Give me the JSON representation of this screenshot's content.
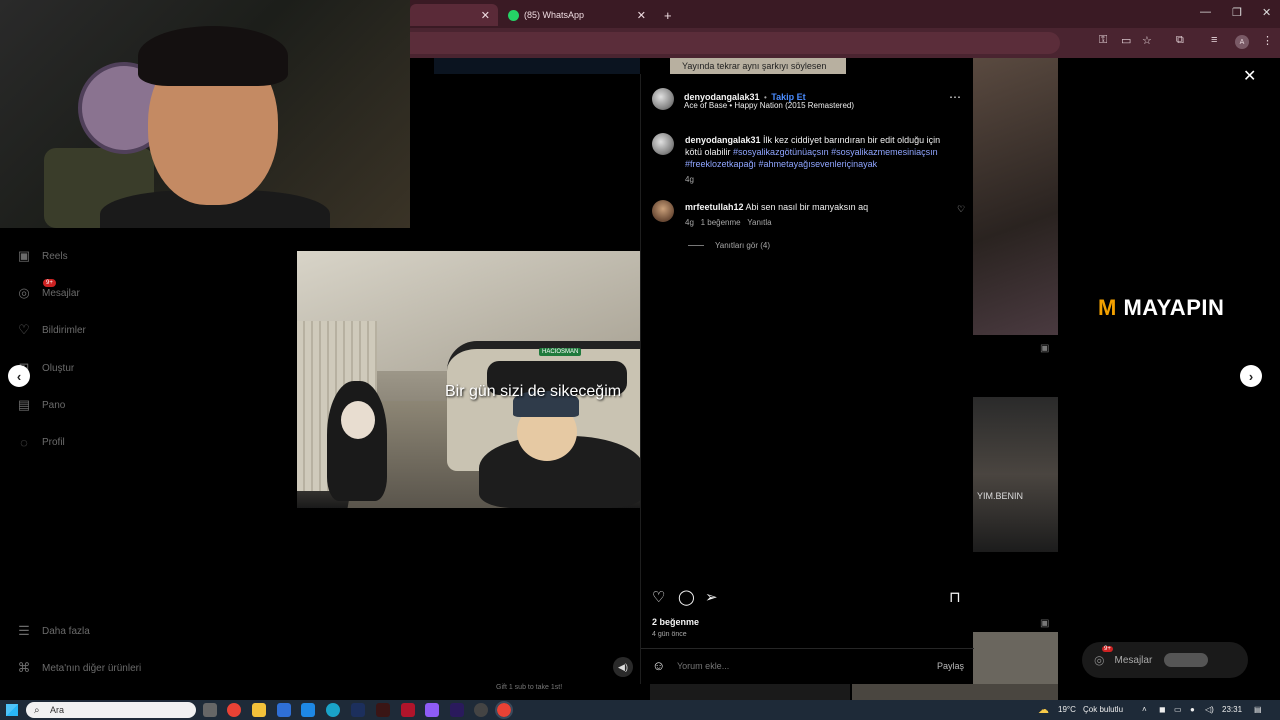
{
  "browser": {
    "tabs": [
      {
        "label": ""
      },
      {
        "label": "(85) WhatsApp"
      }
    ]
  },
  "sidebar": {
    "items": [
      {
        "label": "Reels",
        "icon": "reels-icon"
      },
      {
        "label": "Mesajlar",
        "icon": "messenger-icon",
        "badge": "9+"
      },
      {
        "label": "Bildirimler",
        "icon": "heart-icon"
      },
      {
        "label": "Oluştur",
        "icon": "create-icon"
      },
      {
        "label": "Pano",
        "icon": "dashboard-icon"
      },
      {
        "label": "Profil",
        "icon": "profile-icon"
      }
    ],
    "more": "Daha fazla",
    "meta": "Meta'nın diğer ürünleri"
  },
  "background": {
    "top_banner": "Yayında tekrar aynı şarkıyı söylesen",
    "right_tile_text": "YIM.BENIN",
    "gift_text": "Gift 1 sub to take 1st!"
  },
  "post": {
    "image_caption": "Bir gün sizi de sikeceğim",
    "station_sign": "HACIOSMAN",
    "author": "denyodangalak31",
    "separator": "•",
    "follow": "Takip Et",
    "audio": "Ace of Base • Happy Nation (2015 Remastered)",
    "caption_user": "denyodangalak31",
    "caption_text": "İlk kez ciddiyet barındıran bir edit olduğu için kötü olabilir",
    "caption_tags": "#sosyalikazgötünüaçsın #sosyalikazmemesiniaçsın #freeklozetkapağı #ahmetayağısevenleriçinayak",
    "caption_time": "4g",
    "comment": {
      "user": "mrfeetullah12",
      "text": "Abi sen nasıl bir manyaksın aq",
      "time": "4g",
      "likes": "1 beğenme",
      "reply": "Yanıtla",
      "view_replies": "Yanıtları gör (4)"
    },
    "likes": "2 beğenme",
    "date": "4 gün önce",
    "comment_placeholder": "Yorum ekle...",
    "share": "Paylaş"
  },
  "logo": {
    "brand": "MAYAPIN"
  },
  "dm_pill": {
    "label": "Mesajlar",
    "badge": "9+"
  },
  "taskbar": {
    "search": "Ara",
    "weather_temp": "19°C",
    "weather_text": "Çok bulutlu",
    "time": "23:31"
  },
  "colors": {
    "accent_link": "#4a8cff",
    "hashtag": "#8fa5ff",
    "browser_frame": "#3a1a24",
    "logo_orange": "#f3a100"
  }
}
